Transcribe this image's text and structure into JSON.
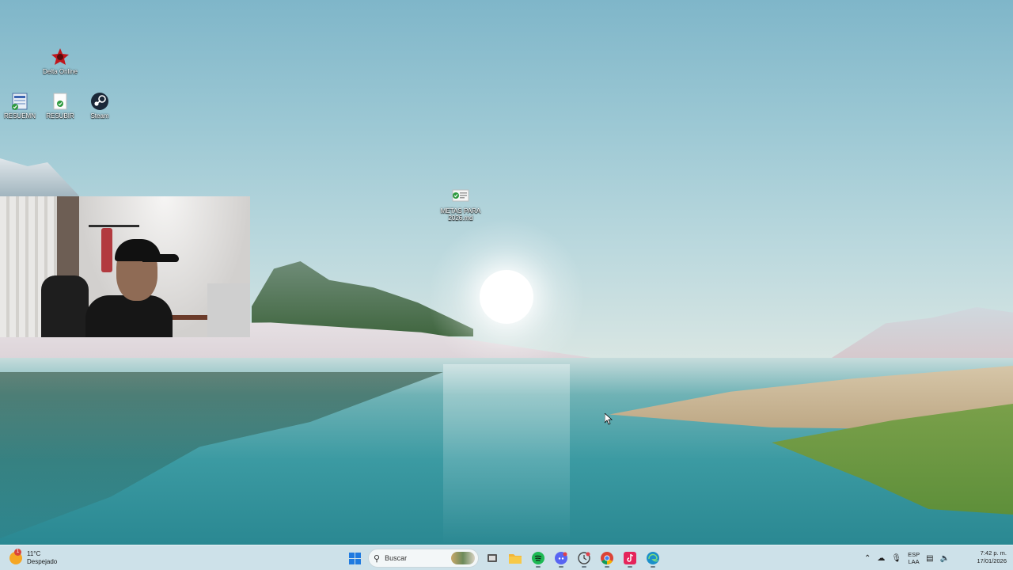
{
  "desktop": {
    "icons": [
      {
        "label": "Delta Online"
      },
      {
        "label": "RESUEMN"
      },
      {
        "label": "RESUBIR"
      },
      {
        "label": "Steam"
      },
      {
        "label": "METAS PARA 2026.md"
      }
    ]
  },
  "taskbar": {
    "weather": {
      "temp": "11°C",
      "condition": "Despejado",
      "badge": "1"
    },
    "search_placeholder": "Buscar",
    "apps": [
      {
        "name": "start-icon"
      },
      {
        "name": "task-view-icon"
      },
      {
        "name": "file-explorer-icon",
        "color": "#f2b53a"
      },
      {
        "name": "spotify-icon",
        "color": "#1db954"
      },
      {
        "name": "discord-icon",
        "color": "#5865f2"
      },
      {
        "name": "app-clock-icon",
        "color": "#444444"
      },
      {
        "name": "chrome-icon",
        "color": "#db4437"
      },
      {
        "name": "tiktok-icon",
        "color": "#e5245a"
      },
      {
        "name": "edge-icon",
        "color": "#1a8fc9"
      }
    ],
    "tray": {
      "lang_top": "ESP",
      "lang_bottom": "LAA"
    },
    "clock": {
      "time": "7:42 p. m.",
      "date": "17/01/2026"
    }
  }
}
